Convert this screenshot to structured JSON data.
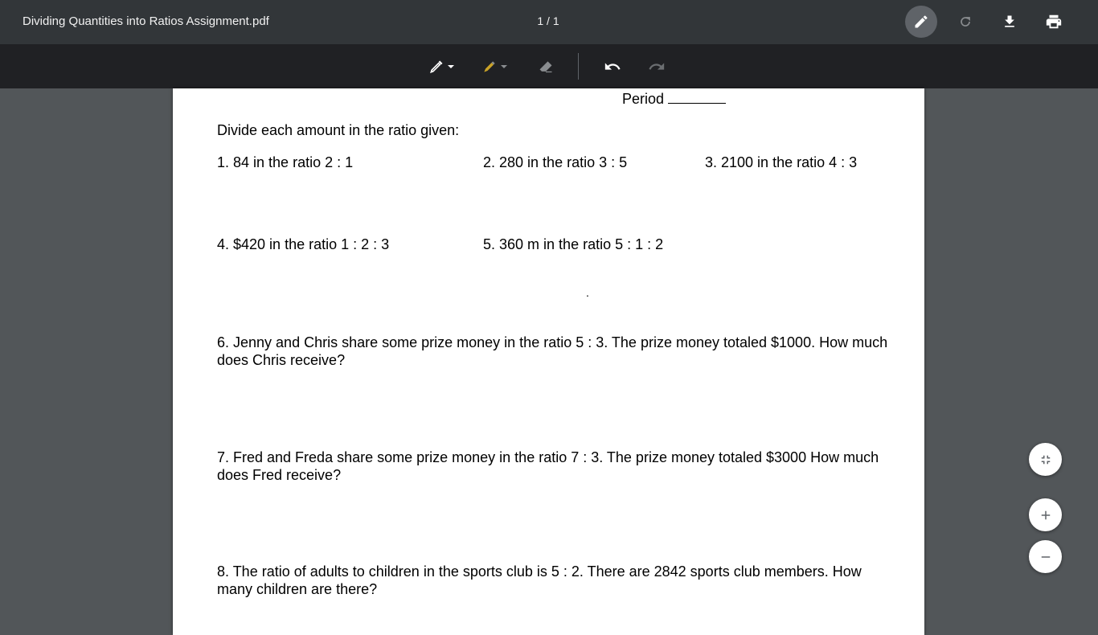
{
  "toolbar": {
    "file_name": "Dividing Quantities into Ratios Assignment.pdf",
    "page_indicator": "1 / 1",
    "icons": {
      "annotate": "pencil-icon",
      "rotate": "rotate-icon",
      "download": "download-icon",
      "print": "print-icon"
    }
  },
  "annotation_bar": {
    "tools": [
      "pen-icon",
      "highlighter-icon",
      "eraser-icon",
      "undo-icon",
      "redo-icon"
    ],
    "highlighter_color": "#c9a227"
  },
  "document": {
    "period_label": "Period",
    "instructions": "Divide each amount in the ratio given:",
    "problems": [
      "1. 84 in the ratio  2 : 1",
      "2.  280 in the ratio 3 : 5",
      "3. 2100 in the ratio 4 : 3",
      "4. $420 in the ratio 1 : 2 : 3",
      "5.  360 m in the ratio  5 : 1 : 2"
    ],
    "dot": ".",
    "word_problems": [
      "6.  Jenny and Chris share some prize money in the ratio 5 : 3.  The prize money totaled $1000.  How much does Chris receive?",
      "7.  Fred and Freda share some prize money in the ratio 7 : 3.  The prize money totaled $3000  How much does Fred receive?",
      "8.  The ratio of adults to children in the sports club is 5 : 2. There are 2842 sports club members. How many children are there?"
    ]
  },
  "zoom_controls": {
    "icons": [
      "fit-to-page-icon",
      "zoom-in-icon",
      "zoom-out-icon"
    ]
  }
}
